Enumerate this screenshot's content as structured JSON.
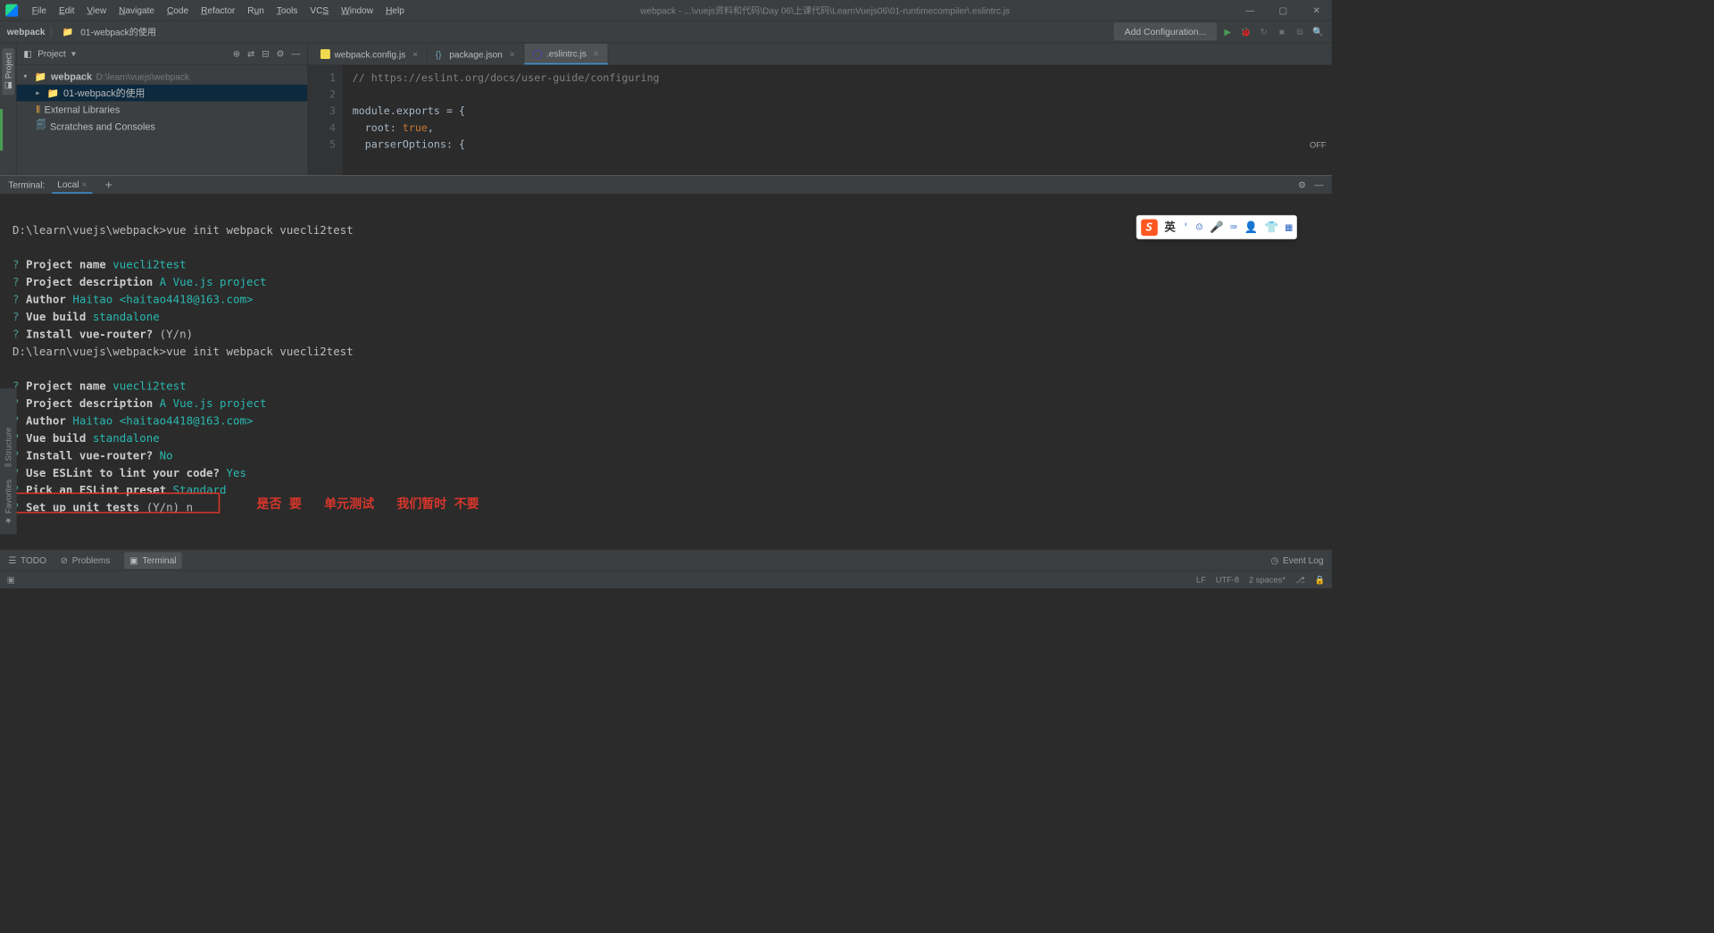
{
  "menu": [
    "File",
    "Edit",
    "View",
    "Navigate",
    "Code",
    "Refactor",
    "Run",
    "Tools",
    "VCS",
    "Window",
    "Help"
  ],
  "window_title": "webpack - ...\\vuejs资料和代码\\Day 06\\上课代码\\LearnVuejs06\\01-runtimecompiler\\.eslintrc.js",
  "breadcrumb": {
    "root": "webpack",
    "item": "01-webpack的使用"
  },
  "config_button": "Add Configuration...",
  "project_panel": {
    "title": "Project",
    "root": {
      "name": "webpack",
      "path": "D:\\learn\\vuejs\\webpack"
    },
    "child": "01-webpack的使用",
    "ext_libs": "External Libraries",
    "scratches": "Scratches and Consoles"
  },
  "tabs": [
    {
      "label": "webpack.config.js",
      "icon": "js",
      "active": false
    },
    {
      "label": "package.json",
      "icon": "json",
      "active": false
    },
    {
      "label": ".eslintrc.js",
      "icon": "eslint",
      "active": true
    }
  ],
  "off_badge": "OFF",
  "code_lines": {
    "l1": "// https://eslint.org/docs/user-guide/configuring",
    "l3_a": "module.exports",
    "l3_b": " = {",
    "l4_a": "root",
    "l4_b": ": ",
    "l4_c": "true",
    "l4_d": ",",
    "l5_a": "parserOptions",
    "l5_b": ": {"
  },
  "gutter": [
    "1",
    "2",
    "3",
    "4",
    "5"
  ],
  "terminal": {
    "title": "Terminal:",
    "tab": "Local",
    "cmd1": "D:\\learn\\vuejs\\webpack>vue init webpack vuecli2test",
    "q_project_name_l": "Project name",
    "q_project_name_v": "vuecli2test",
    "q_project_desc_l": "Project description",
    "q_project_desc_v": "A Vue.js project",
    "q_author_l": "Author",
    "q_author_v": "Haitao <haitao4418@163.com>",
    "q_vue_build_l": "Vue build",
    "q_vue_build_v": "standalone",
    "q_router_l": "Install vue-router?",
    "q_router_yn": "(Y/n)",
    "q_router_v": "No",
    "q_eslint_l": "Use ESLint to lint your code?",
    "q_eslint_v": "Yes",
    "q_preset_l": "Pick an ESLint preset",
    "q_preset_v": "Standard",
    "q_unit_l": "Set up unit tests",
    "q_unit_yn": "(Y/n)",
    "q_unit_v": "n",
    "annotation": "是否 要   单元测试   我们暂时 不要"
  },
  "ime": {
    "lang": "英"
  },
  "bottom_tabs": {
    "todo": "TODO",
    "problems": "Problems",
    "terminal": "Terminal"
  },
  "event_log": "Event Log",
  "statusbar": {
    "lf": "LF",
    "enc": "UTF-8",
    "indent": "2 spaces*"
  },
  "sidebar": {
    "project": "Project",
    "structure": "Structure",
    "favorites": "Favorites"
  }
}
